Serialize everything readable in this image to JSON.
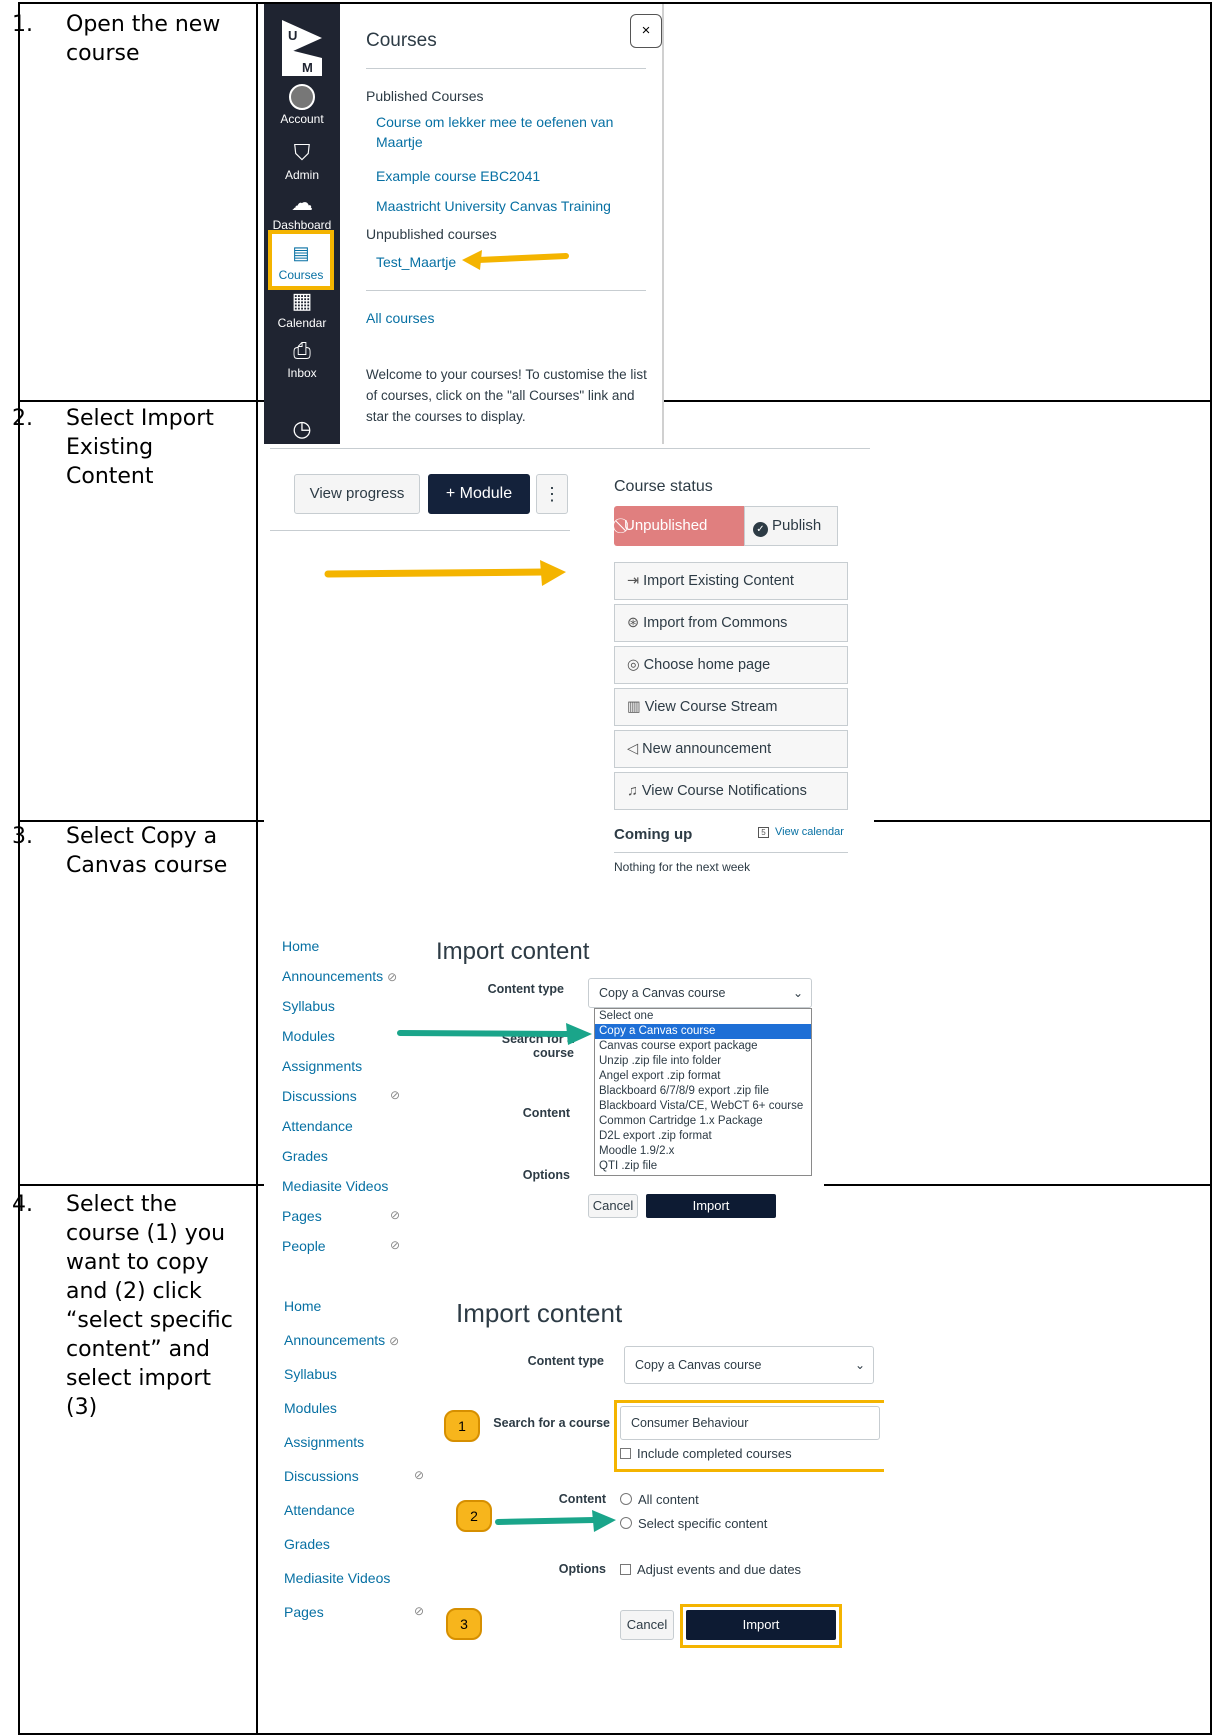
{
  "steps": [
    {
      "num": "1.",
      "text": "Open the new course"
    },
    {
      "num": "2.",
      "text": "Select Import Existing Content"
    },
    {
      "num": "3.",
      "text": "Select Copy a Canvas course"
    },
    {
      "num": "4.",
      "text": "Select the course (1) you want to copy and (2) click “select specific content” and select import (3)"
    }
  ],
  "step1": {
    "nav": [
      "Account",
      "Admin",
      "Dashboard",
      "Courses",
      "Calendar",
      "Inbox"
    ],
    "title": "Courses",
    "close": "×",
    "published_heading": "Published Courses",
    "published": [
      "Course om lekker mee te oefenen van Maartje",
      "Example course EBC2041",
      "Maastricht University Canvas Training"
    ],
    "unpublished_heading": "Unpublished courses",
    "unpublished": [
      "Test_Maartje"
    ],
    "all_courses": "All courses",
    "welcome": "Welcome to your courses! To customise the list of courses, click on the \"all Courses\" link and star the courses to display."
  },
  "step2": {
    "view_progress": "View progress",
    "module": "+ Module",
    "more": "⋮",
    "course_status": "Course status",
    "unpublished": "⃠Unpublished",
    "publish": "Publish",
    "actions": [
      "Import Existing Content",
      "Import from Commons",
      "Choose home page",
      "View Course Stream",
      "New announcement",
      "View Course Notifications"
    ],
    "coming_up": "Coming up",
    "view_calendar": "View calendar",
    "nothing": "Nothing for the next week"
  },
  "step3": {
    "nav": [
      "Home",
      "Announcements",
      "Syllabus",
      "Modules",
      "Assignments",
      "Discussions",
      "Attendance",
      "Grades",
      "Mediasite Videos",
      "Pages",
      "People"
    ],
    "heading": "Import content",
    "content_type_label": "Content type",
    "content_type_value": "Copy a Canvas course",
    "search_label": "Search for a course",
    "content_label": "Content",
    "options_label": "Options",
    "dropdown": [
      "Select one",
      "Copy a Canvas course",
      "Canvas course export package",
      "Unzip .zip file into folder",
      "Angel export .zip format",
      "Blackboard 6/7/8/9 export .zip file",
      "Blackboard Vista/CE, WebCT 6+ course",
      "Common Cartridge 1.x Package",
      "D2L export .zip format",
      "Moodle 1.9/2.x",
      "QTI .zip file"
    ],
    "cancel": "Cancel",
    "import": "Import"
  },
  "step4": {
    "nav": [
      "Home",
      "Announcements",
      "Syllabus",
      "Modules",
      "Assignments",
      "Discussions",
      "Attendance",
      "Grades",
      "Mediasite Videos",
      "Pages"
    ],
    "heading": "Import content",
    "content_type_label": "Content type",
    "content_type_value": "Copy a Canvas course",
    "search_label": "Search for a course",
    "search_value": "Consumer Behaviour",
    "include_completed": "Include completed courses",
    "content_label": "Content",
    "all_content": "All content",
    "select_specific": "Select specific content",
    "options_label": "Options",
    "adjust_dates": "Adjust events and due dates",
    "cancel": "Cancel",
    "import": "Import",
    "badges": [
      "1",
      "2",
      "3"
    ]
  },
  "colors": {
    "arrow_orange": "#f4b400",
    "arrow_teal": "#1aa58a",
    "highlight": "#f4b400",
    "canvas_nav": "#1f2431",
    "link": "#0770a3"
  }
}
